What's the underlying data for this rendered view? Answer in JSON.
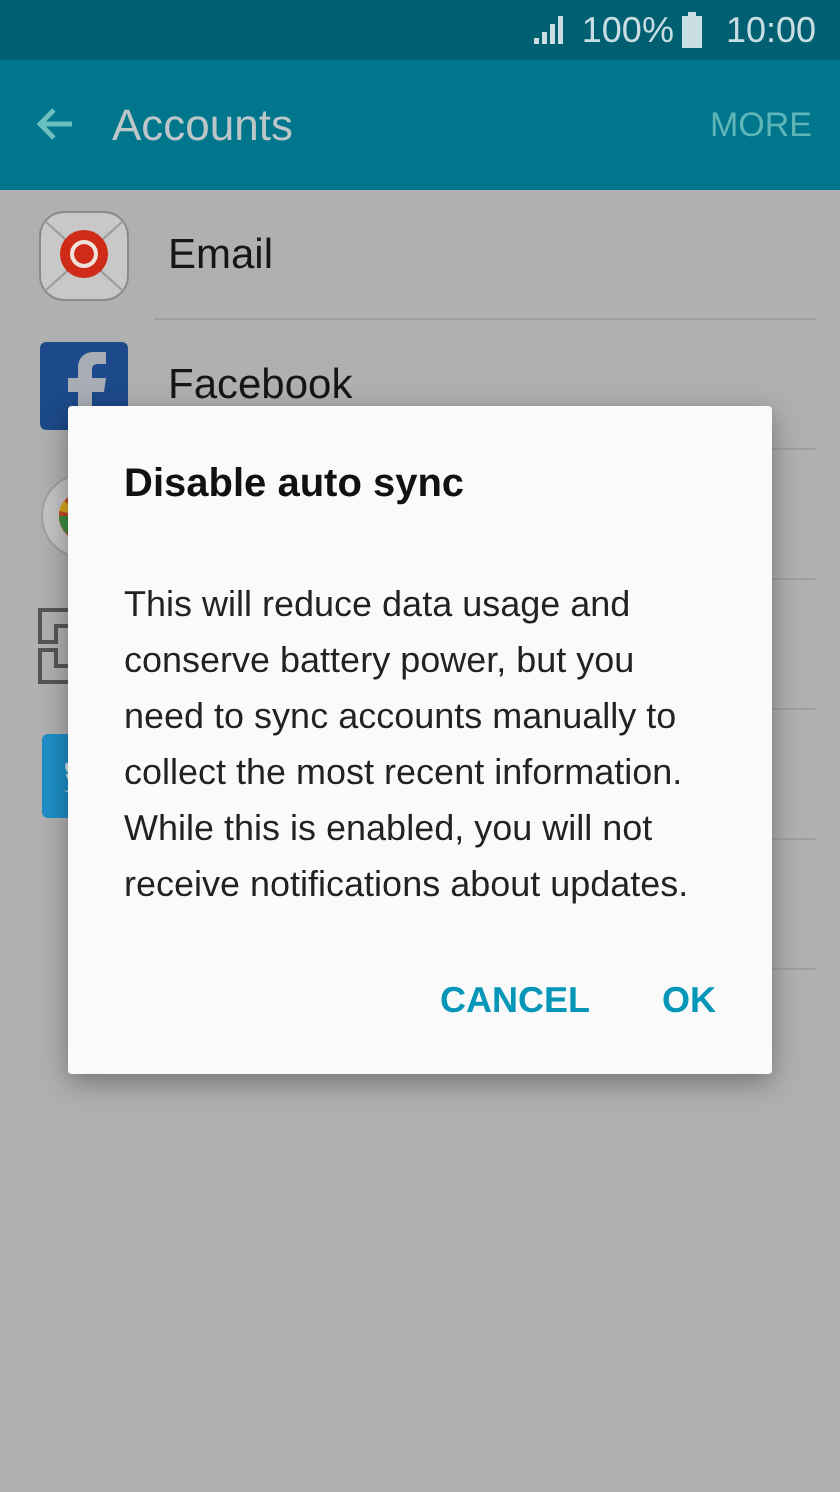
{
  "status_bar": {
    "battery": "100%",
    "time": "10:00"
  },
  "app_bar": {
    "title": "Accounts",
    "action": "MORE"
  },
  "accounts": [
    {
      "kind": "email",
      "label": "Email"
    },
    {
      "kind": "facebook",
      "label": "Facebook"
    },
    {
      "kind": "google"
    },
    {
      "kind": "samsung"
    },
    {
      "kind": "twitter"
    },
    {
      "kind": "blank"
    }
  ],
  "dialog": {
    "title": "Disable auto sync",
    "message": "This will reduce data usage and conserve battery power, but you need to sync accounts manually to collect the most recent information. While this is enabled, you will not receive notifications about updates.",
    "buttons": [
      "CANCEL",
      "OK"
    ]
  }
}
